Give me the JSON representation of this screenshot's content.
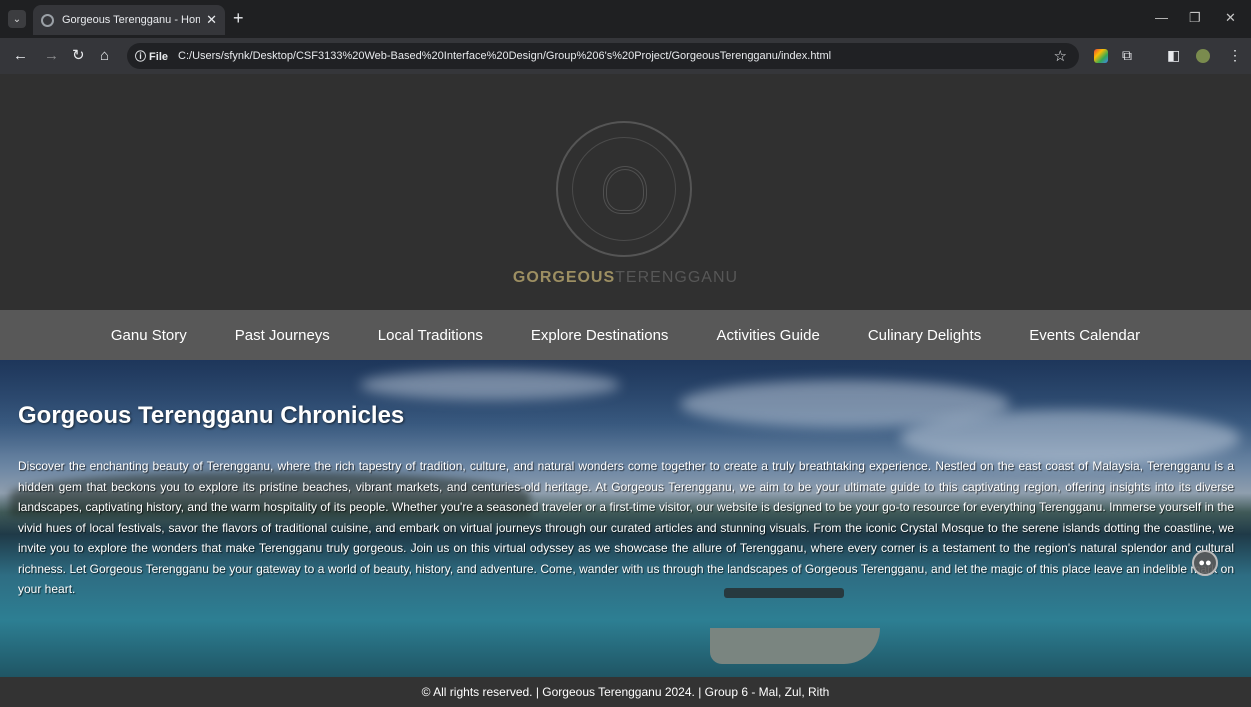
{
  "browser": {
    "tab_title": "Gorgeous Terengganu - Homep",
    "file_chip": "ⓘ File",
    "url": "C:/Users/sfynk/Desktop/CSF3133%20Web-Based%20Interface%20Design/Group%206's%20Project/GorgeousTerengganu/index.html"
  },
  "header": {
    "brand_a": "GORGEOUS",
    "brand_b": "TERENGGANU"
  },
  "nav": {
    "items": [
      "Ganu Story",
      "Past Journeys",
      "Local Traditions",
      "Explore Destinations",
      "Activities Guide",
      "Culinary Delights",
      "Events Calendar"
    ]
  },
  "hero": {
    "title": "Gorgeous Terengganu Chronicles",
    "text": "Discover the enchanting beauty of Terengganu, where the rich tapestry of tradition, culture, and natural wonders come together to create a truly breathtaking experience. Nestled on the east coast of Malaysia, Terengganu is a hidden gem that beckons you to explore its pristine beaches, vibrant markets, and centuries-old heritage. At Gorgeous Terengganu, we aim to be your ultimate guide to this captivating region, offering insights into its diverse landscapes, captivating history, and the warm hospitality of its people. Whether you're a seasoned traveler or a first-time visitor, our website is designed to be your go-to resource for everything Terengganu. Immerse yourself in the vivid hues of local festivals, savor the flavors of traditional cuisine, and embark on virtual journeys through our curated articles and stunning visuals. From the iconic Crystal Mosque to the serene islands dotting the coastline, we invite you to explore the wonders that make Terengganu truly gorgeous. Join us on this virtual odyssey as we showcase the allure of Terengganu, where every corner is a testament to the region's natural splendor and cultural richness. Let Gorgeous Terengganu be your gateway to a world of beauty, history, and adventure. Come, wander with us through the landscapes of Gorgeous Terengganu, and let the magic of this place leave an indelible mark on your heart."
  },
  "footer": {
    "text": "© All rights reserved. | Gorgeous Terengganu 2024. | Group 6 - Mal, Zul, Rith"
  }
}
